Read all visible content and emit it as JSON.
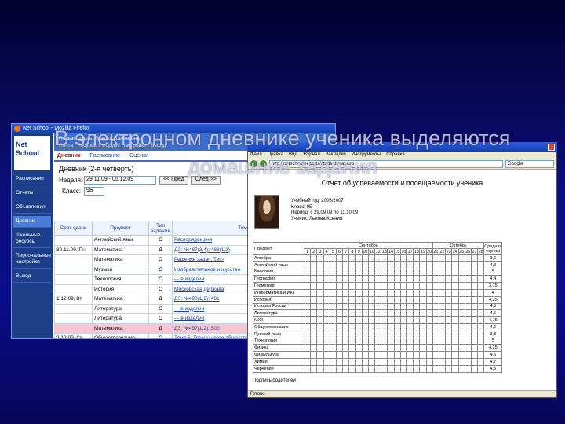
{
  "slide": {
    "title": "В электронном дневнике ученика выделяются домашние задания"
  },
  "left_window": {
    "title": "Net School - Mozilla Firefox",
    "logo_line1": "Net",
    "logo_line2": "School",
    "sidebar": [
      "Расписание",
      "Отчеты",
      "Объявления",
      "Дневник",
      "Школьные ресурсы",
      "Персональные настройки",
      "Выход"
    ],
    "header_user": "Пользователь: Лыкова Валентина",
    "header_links": "Почта / Ресурсы / Форум / Настройки / Выход",
    "tabs": [
      "Дневник",
      "Расписание",
      "Оценки"
    ],
    "pane_title": "Дневник (2-я четверть)",
    "week_label": "Неделя:",
    "week_value": "29.11.09 - 05.12.09",
    "prev_button": "<< Пред",
    "next_button": "След >>",
    "class_label": "Класс:",
    "class_value": "9Б",
    "table_headers": [
      "Срок сдачи",
      "Предмет",
      "Тип задания",
      "Тема задания"
    ],
    "rows": [
      {
        "date": "",
        "subject": "Английский язык",
        "type": "С",
        "topic": "Распорядок дня"
      },
      {
        "date": "30.11.09, Пн",
        "subject": "Математика",
        "type": "Д",
        "topic": "ДЗ: №487(3,4); 488(1,2)"
      },
      {
        "date": "",
        "subject": "Математика",
        "type": "С",
        "topic": "Решение задач. Тест"
      },
      {
        "date": "",
        "subject": "Музыка",
        "type": "С",
        "topic": "Изобразительное искусство"
      },
      {
        "date": "",
        "subject": "Технология",
        "type": "С",
        "topic": "--- в изделии"
      },
      {
        "date": "",
        "subject": "История",
        "type": "С",
        "topic": "Московская держава"
      },
      {
        "date": "1.12.09, Вт",
        "subject": "Математика",
        "type": "Д",
        "topic": "ДЗ: №490(1,2); 491"
      },
      {
        "date": "",
        "subject": "Литература",
        "type": "С",
        "topic": "--- в изделии"
      },
      {
        "date": "",
        "subject": "Литература",
        "type": "С",
        "topic": "--- в изделии"
      },
      {
        "date": "",
        "subject": "Математика",
        "type": "Д",
        "topic": "ДЗ: №497(1,2); 500"
      },
      {
        "date": "2.12.09, Ср",
        "subject": "Обществознание",
        "type": "С",
        "topic": "Тема 5. Гражданское общество"
      }
    ]
  },
  "right_window": {
    "menu": [
      "Файл",
      "Правка",
      "Вид",
      "Журнал",
      "Закладки",
      "Инструменты",
      "Справка"
    ],
    "address": "http://netschool/reports/studenttotal.asp",
    "search_placeholder": "Google",
    "report_title": "Отчет об успеваемости и посещаемости ученика",
    "info": [
      "Учебный год: 2006/2007",
      "Класс: 9Б",
      "Период: с 29.09.09 по 11.10.09",
      "Ученик: Лыкова Ксения"
    ],
    "table_subject_header": "Предмет",
    "table_month1": "Сентябрь",
    "table_month2": "Октябрь",
    "table_avg_header": "Средняя оценка",
    "days": [
      "1",
      "2",
      "3",
      "4",
      "5",
      "6",
      "7",
      "8",
      "9",
      "10",
      "11",
      "12",
      "13",
      "14",
      "15",
      "16",
      "17",
      "18",
      "19",
      "20",
      "21",
      "22",
      "23",
      "24",
      "25",
      "26",
      "27",
      "28"
    ],
    "subjects": [
      "Алгебра",
      "Английский язык",
      "Биология",
      "География",
      "Геометрия",
      "Информатика и ИКТ",
      "История",
      "История России",
      "Литература",
      "МХК",
      "Обществознание",
      "Русский язык",
      "Технология",
      "Физика",
      "Физкультура",
      "Химия",
      "Черчение"
    ],
    "averages": [
      "3,6",
      "4,3",
      "5",
      "4,4",
      "3,75",
      "4",
      "4,25",
      "4,5",
      "4,5",
      "4,75",
      "4,6",
      "3,8",
      "5",
      "4,25",
      "4,5",
      "4,7",
      "4,5"
    ],
    "signature": "Подпись родителей",
    "status": "Готово"
  }
}
